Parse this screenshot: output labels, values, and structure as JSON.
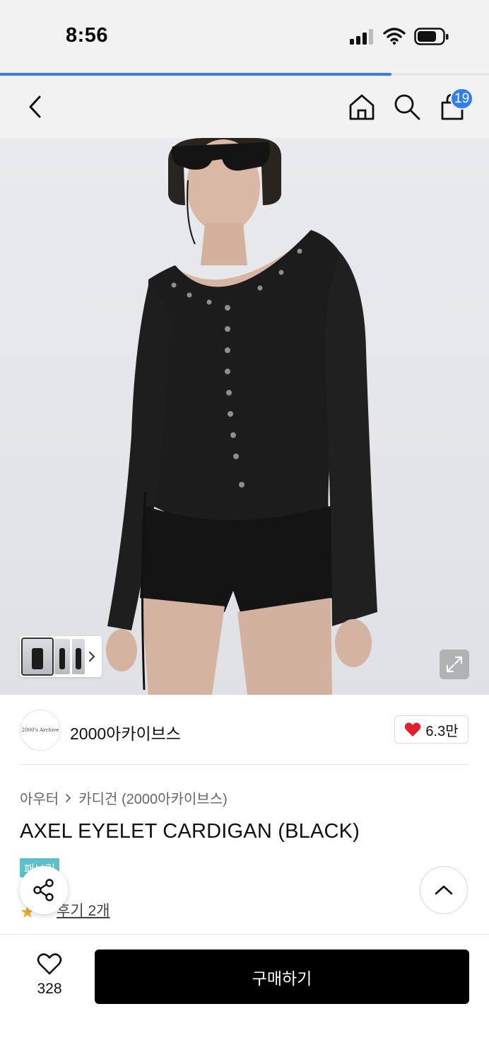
{
  "status": {
    "time": "8:56"
  },
  "page_load_progress": 0.8,
  "nav": {
    "cart_count": "19"
  },
  "gallery": {
    "thumbnail_count": 3
  },
  "brand": {
    "logo_text": "2000's Archive",
    "name": "2000아카이브스",
    "likes": "6.3만"
  },
  "breadcrumb": {
    "category": "아우터",
    "subcategory": "카디건 (2000아카이브스)"
  },
  "product": {
    "title": "AXEL EYELET CARDIGAN (BLACK)",
    "badge": "패브릭"
  },
  "reviews": {
    "label": "후기 2개"
  },
  "bottom": {
    "wish_count": "328",
    "buy_label": "구매하기"
  },
  "colors": {
    "accent": "#2f7ff0",
    "badge": "#5cc2c9",
    "buy_button": "#000000",
    "heart": "#e0202c",
    "star": "#f5a623"
  }
}
